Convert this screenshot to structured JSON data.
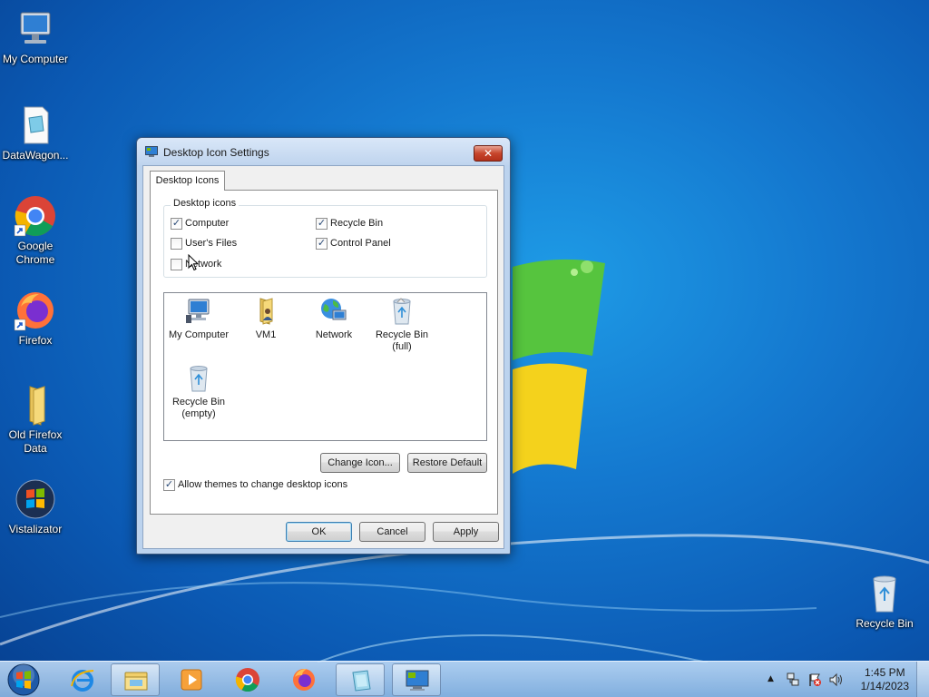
{
  "desktop": {
    "icons": [
      {
        "label": "My Computer",
        "icon": "my-computer-icon"
      },
      {
        "label": "DataWagon...",
        "icon": "document-icon"
      },
      {
        "label": "Google Chrome",
        "icon": "chrome-icon"
      },
      {
        "label": "Firefox",
        "icon": "firefox-icon"
      },
      {
        "label": "Old Firefox Data",
        "icon": "folder-icon"
      },
      {
        "label": "Vistalizator",
        "icon": "vistalizator-icon"
      },
      {
        "label": "Recycle Bin",
        "icon": "recycle-bin-icon"
      }
    ]
  },
  "dialog": {
    "title": "Desktop Icon Settings",
    "close_label": "✕",
    "tab_label": "Desktop Icons",
    "group_title": "Desktop icons",
    "checkboxes": [
      {
        "label": "Computer",
        "checked": true
      },
      {
        "label": "Recycle Bin",
        "checked": true
      },
      {
        "label": "User's Files",
        "checked": false
      },
      {
        "label": "Control Panel",
        "checked": true
      },
      {
        "label": "Network",
        "checked": false
      }
    ],
    "icon_list": [
      {
        "label": "My Computer",
        "icon": "my-computer-icon"
      },
      {
        "label": "VM1",
        "icon": "user-folder-icon"
      },
      {
        "label": "Network",
        "icon": "network-icon"
      },
      {
        "label": "Recycle Bin\n(full)",
        "icon": "recycle-bin-full-icon"
      },
      {
        "label": "Recycle Bin\n(empty)",
        "icon": "recycle-bin-empty-icon"
      }
    ],
    "change_icon_label": "Change Icon...",
    "restore_default_label": "Restore Default",
    "allow_themes": {
      "label": "Allow themes to change desktop icons",
      "checked": true
    },
    "ok_label": "OK",
    "cancel_label": "Cancel",
    "apply_label": "Apply"
  },
  "taskbar": {
    "pinned": [
      {
        "name": "internet-explorer-icon",
        "active": false
      },
      {
        "name": "windows-explorer-icon",
        "active": true
      },
      {
        "name": "media-player-icon",
        "active": false
      },
      {
        "name": "chrome-icon",
        "active": false
      },
      {
        "name": "firefox-icon",
        "active": false
      },
      {
        "name": "datawagon-icon",
        "active": true
      },
      {
        "name": "desktop-settings-icon",
        "active": true
      }
    ],
    "tray": {
      "up_arrow": "▲",
      "time": "1:45 PM",
      "date": "1/14/2023"
    }
  }
}
